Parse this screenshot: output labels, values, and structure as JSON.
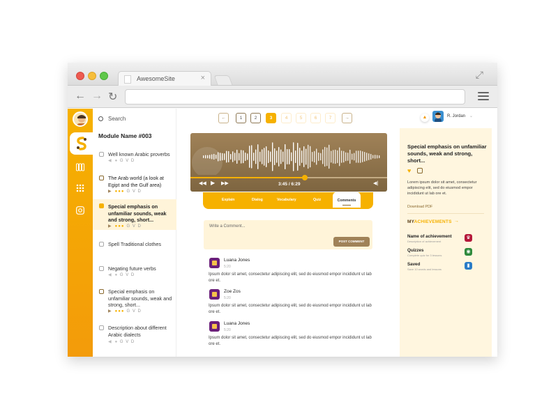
{
  "browser": {
    "tab_title": "AwesomeSite",
    "tab_close": "×",
    "url": ""
  },
  "sidebar": {
    "search_label": "Search",
    "module_name": "Module Name #003",
    "lessons": [
      {
        "title": "Well known Arabic proverbs",
        "meta": "G V D",
        "state": "unstarted"
      },
      {
        "title": "The Arab world (a look at Egipt and the Gulf area)",
        "meta": "G V D",
        "state": "in-progress"
      },
      {
        "title": "Special emphasis on unfamiliar sounds, weak and strong, short...",
        "meta": "G V D",
        "state": "playing"
      },
      {
        "title": "Spell Traditional clothes",
        "meta": "",
        "state": "unstarted"
      },
      {
        "title": "Negating future verbs",
        "meta": "G V D",
        "state": "unstarted"
      },
      {
        "title": "Special emphasis on unfamiliar sounds, weak and strong, short...",
        "meta": "G V D",
        "state": "in-progress"
      },
      {
        "title": "Description about different Arabic dialects",
        "meta": "G V D",
        "state": "unstarted"
      }
    ]
  },
  "pager": {
    "pages": [
      "1",
      "2",
      "3",
      "4",
      "5",
      "6",
      "7"
    ],
    "current": "3"
  },
  "player": {
    "time": "3:45 / 6:29",
    "progress": 0.58
  },
  "content_tabs": [
    "Explain",
    "Dialog",
    "Vocabulary",
    "Quiz",
    "Comments"
  ],
  "active_tab": "Comments",
  "comment_form": {
    "placeholder": "Write a Comment...",
    "post_label": "POST COMMENT"
  },
  "comments": [
    {
      "name": "Luana Jones",
      "time": "5:20",
      "text": "Ipsum dolor sit amet, consectetur adipiscing elit, sed do eiusmod empor incididunt ut lab ore et."
    },
    {
      "name": "Zoe Zos",
      "time": "5:20",
      "text": "Ipsum dolor sit amet, consectetur adipiscing elit, sed do eiusmod empor incididunt ut lab ore et."
    },
    {
      "name": "Luana Jones",
      "time": "5:20",
      "text": "Ipsum dolor sit amet, consectetur adipiscing elit, sed do eiusmod empor incididunt ut lab ore et."
    }
  ],
  "user": {
    "name": "R. Jordan"
  },
  "right_panel": {
    "title": "Special emphasis on unfamiliar sounds, weak and strong, short...",
    "description": "Lorem ipsum dolor sit amet, consectetur adipiscing elit, sed do eiusmod empor incididunt ut lab ore et.",
    "download": "Download PDF",
    "achievements_prefix": "MY",
    "achievements_word": "ACHIEVEMENTS",
    "achievements": [
      {
        "name": "Name of achievement",
        "sub": "Description of achievement",
        "icon": "trophy-icon",
        "color": "#b5183a"
      },
      {
        "name": "Quizzes",
        "sub": "Complete quiz for 3 lessons",
        "icon": "quiz-icon",
        "color": "#2f8a3c"
      },
      {
        "name": "Saved",
        "sub": "Save 10 words and lessons",
        "icon": "bookmark-icon",
        "color": "#2a7cc7"
      }
    ]
  },
  "colors": {
    "accent": "#f6b100",
    "brown": "#a08258",
    "panel": "#fff6df"
  }
}
